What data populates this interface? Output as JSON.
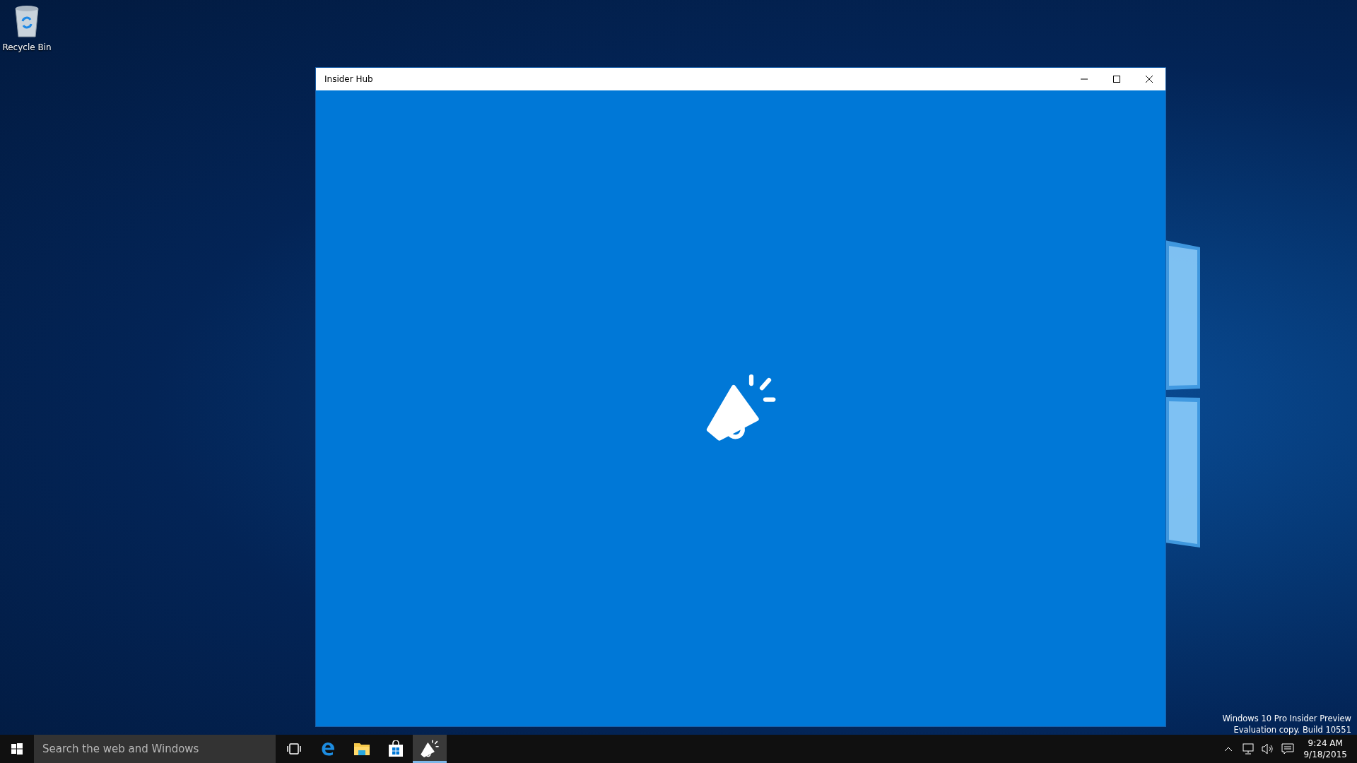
{
  "desktop": {
    "icons": [
      {
        "label": "Recycle Bin"
      }
    ],
    "edition_notice": [
      "Windows 10 Pro Insider Preview",
      "Evaluation copy. Build 10551"
    ]
  },
  "window": {
    "title": "Insider Hub"
  },
  "taskbar": {
    "search": {
      "placeholder": "Search the web and Windows"
    },
    "apps": [
      {
        "kind": "task-view",
        "selected": false
      },
      {
        "kind": "edge",
        "selected": false
      },
      {
        "kind": "file-explorer",
        "selected": false
      },
      {
        "kind": "store",
        "selected": false
      },
      {
        "kind": "insider-hub",
        "selected": true
      }
    ],
    "tray": {
      "time": "9:24 AM",
      "date": "9/18/2015"
    }
  }
}
